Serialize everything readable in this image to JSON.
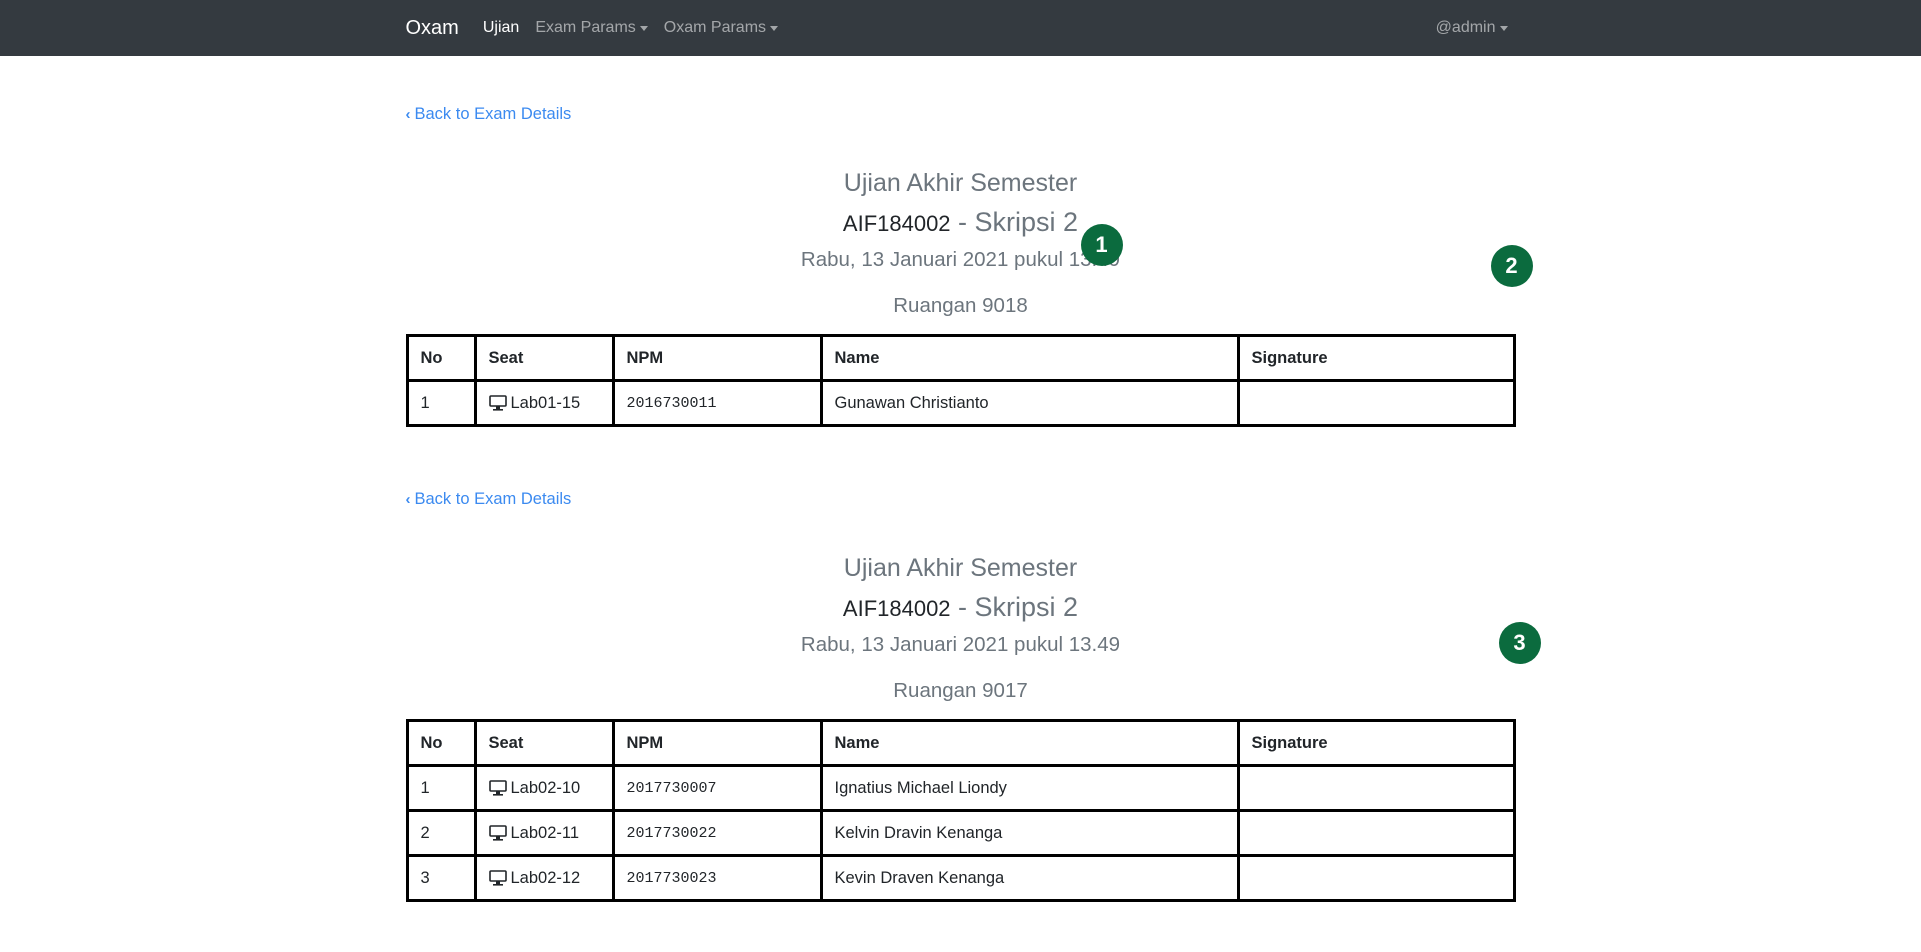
{
  "navbar": {
    "brand": "Oxam",
    "items": [
      {
        "label": "Ujian"
      },
      {
        "label": "Exam Params"
      },
      {
        "label": "Oxam Params"
      }
    ],
    "user": "@admin"
  },
  "sections": [
    {
      "back_label": "Back to Exam Details",
      "exam_title": "Ujian Akhir Semester",
      "course_code": "AIF184002",
      "course_sep": " - ",
      "course_name": "Skripsi 2",
      "datetime": "Rabu, 13 Januari 2021 pukul 13.49",
      "room": "Ruangan 9018",
      "headers": [
        "No",
        "Seat",
        "NPM",
        "Name",
        "Signature"
      ],
      "rows": [
        {
          "no": "1",
          "seat": "Lab01-15",
          "npm": "2016730011",
          "name": "Gunawan Christianto",
          "signature": ""
        }
      ]
    },
    {
      "back_label": "Back to Exam Details",
      "exam_title": "Ujian Akhir Semester",
      "course_code": "AIF184002",
      "course_sep": " - ",
      "course_name": "Skripsi 2",
      "datetime": "Rabu, 13 Januari 2021 pukul 13.49",
      "room": "Ruangan 9017",
      "headers": [
        "No",
        "Seat",
        "NPM",
        "Name",
        "Signature"
      ],
      "rows": [
        {
          "no": "1",
          "seat": "Lab02-10",
          "npm": "2017730007",
          "name": "Ignatius Michael Liondy",
          "signature": ""
        },
        {
          "no": "2",
          "seat": "Lab02-11",
          "npm": "2017730022",
          "name": "Kelvin Dravin Kenanga",
          "signature": ""
        },
        {
          "no": "3",
          "seat": "Lab02-12",
          "npm": "2017730023",
          "name": "Kevin Draven Kenanga",
          "signature": ""
        }
      ]
    }
  ],
  "badges": [
    "1",
    "2",
    "3"
  ],
  "colors": {
    "navbar": "#343a40",
    "link": "#3b8af0",
    "badge": "#0b6b3e"
  },
  "icons": {
    "back": "chevron-left-icon",
    "seat": "monitor-icon"
  }
}
